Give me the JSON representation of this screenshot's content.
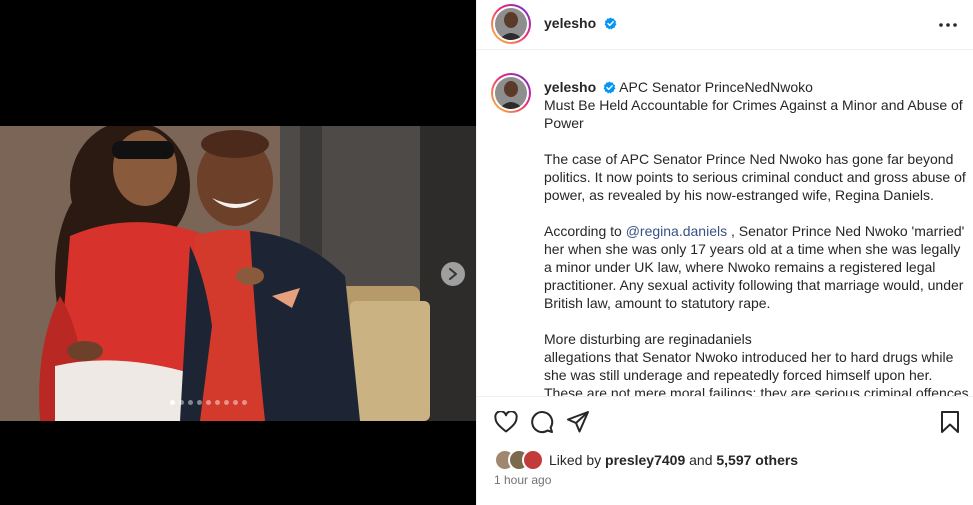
{
  "header": {
    "username": "yelesho",
    "avatar_icon": "profile-avatar",
    "more_icon": "more-options-icon"
  },
  "caption": {
    "username": "yelesho",
    "title_part1": "APC Senator PrinceNedNwoko",
    "title_part2": "Must Be Held Accountable for Crimes Against a Minor and Abuse of Power",
    "para1": "The case of APC Senator Prince Ned Nwoko has gone far beyond politics. It now points to serious criminal conduct and gross abuse of power, as revealed by his now-estranged wife, Regina Daniels.",
    "para2_before": "According to ",
    "para2_mention": "@regina.daniels",
    "para2_after": " , Senator Prince Ned Nwoko 'married' her when she was only 17 years old at a time when she was legally a minor under UK law, where Nwoko remains a registered legal practitioner. Any sexual activity following that marriage would, under British law, amount to statutory rape.",
    "para3_line1": "More disturbing are reginadaniels",
    "para3_rest": "allegations that Senator Nwoko introduced her to hard drugs while she was still underage and repeatedly forced himself upon her. These are not mere moral failings; they are serious criminal offences"
  },
  "likes": {
    "prefix": "Liked by",
    "user": "presley7409",
    "and": "and",
    "count": "5,597 others"
  },
  "timestamp": "1 hour ago",
  "colors": {
    "link": "#385185",
    "verified": "#0095f6",
    "muted": "#737373"
  }
}
